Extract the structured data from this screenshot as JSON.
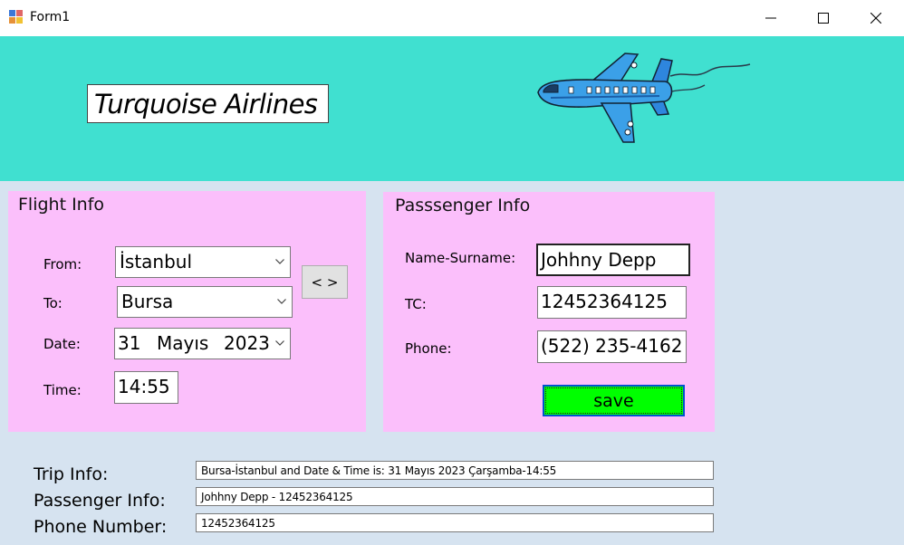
{
  "window": {
    "title": "Form1",
    "icon": "winforms-app-icon",
    "controls": [
      "minimize-icon",
      "maximize-icon",
      "close-icon"
    ]
  },
  "banner": {
    "brand": "Turquoise Airlines",
    "image": "airplane-illustration",
    "background": "#40e0d0"
  },
  "flight": {
    "title": "Flight Info",
    "from_label": "From:",
    "from_value": "İstanbul",
    "to_label": "To:",
    "to_value": "Bursa",
    "date_label": "Date:",
    "date_day": "31",
    "date_month": "Mayıs",
    "date_year": "2023",
    "time_label": "Time:",
    "time_value": "14:55",
    "swap_label": "< >"
  },
  "passenger": {
    "title": "Passsenger Info",
    "name_label": "Name-Surname:",
    "name_value": "Johhny Depp",
    "tc_label": "TC:",
    "tc_value": "12452364125",
    "phone_label": "Phone:",
    "phone_value": "(522) 235-4162",
    "save_label": "save"
  },
  "summary": {
    "trip_label": "Trip Info:",
    "trip_value": "Bursa-İstanbul and Date & Time is: 31 Mayıs 2023 Çarşamba-14:55",
    "passenger_label": "Passenger Info:",
    "passenger_value": "Johhny Depp - 12452364125",
    "phone_label": "Phone Number:",
    "phone_value": "12452364125"
  },
  "colors": {
    "panel": "#fbbffb",
    "form_background": "#d6e3f0",
    "save_button": "#00ff00",
    "save_border": "#0052cc"
  }
}
